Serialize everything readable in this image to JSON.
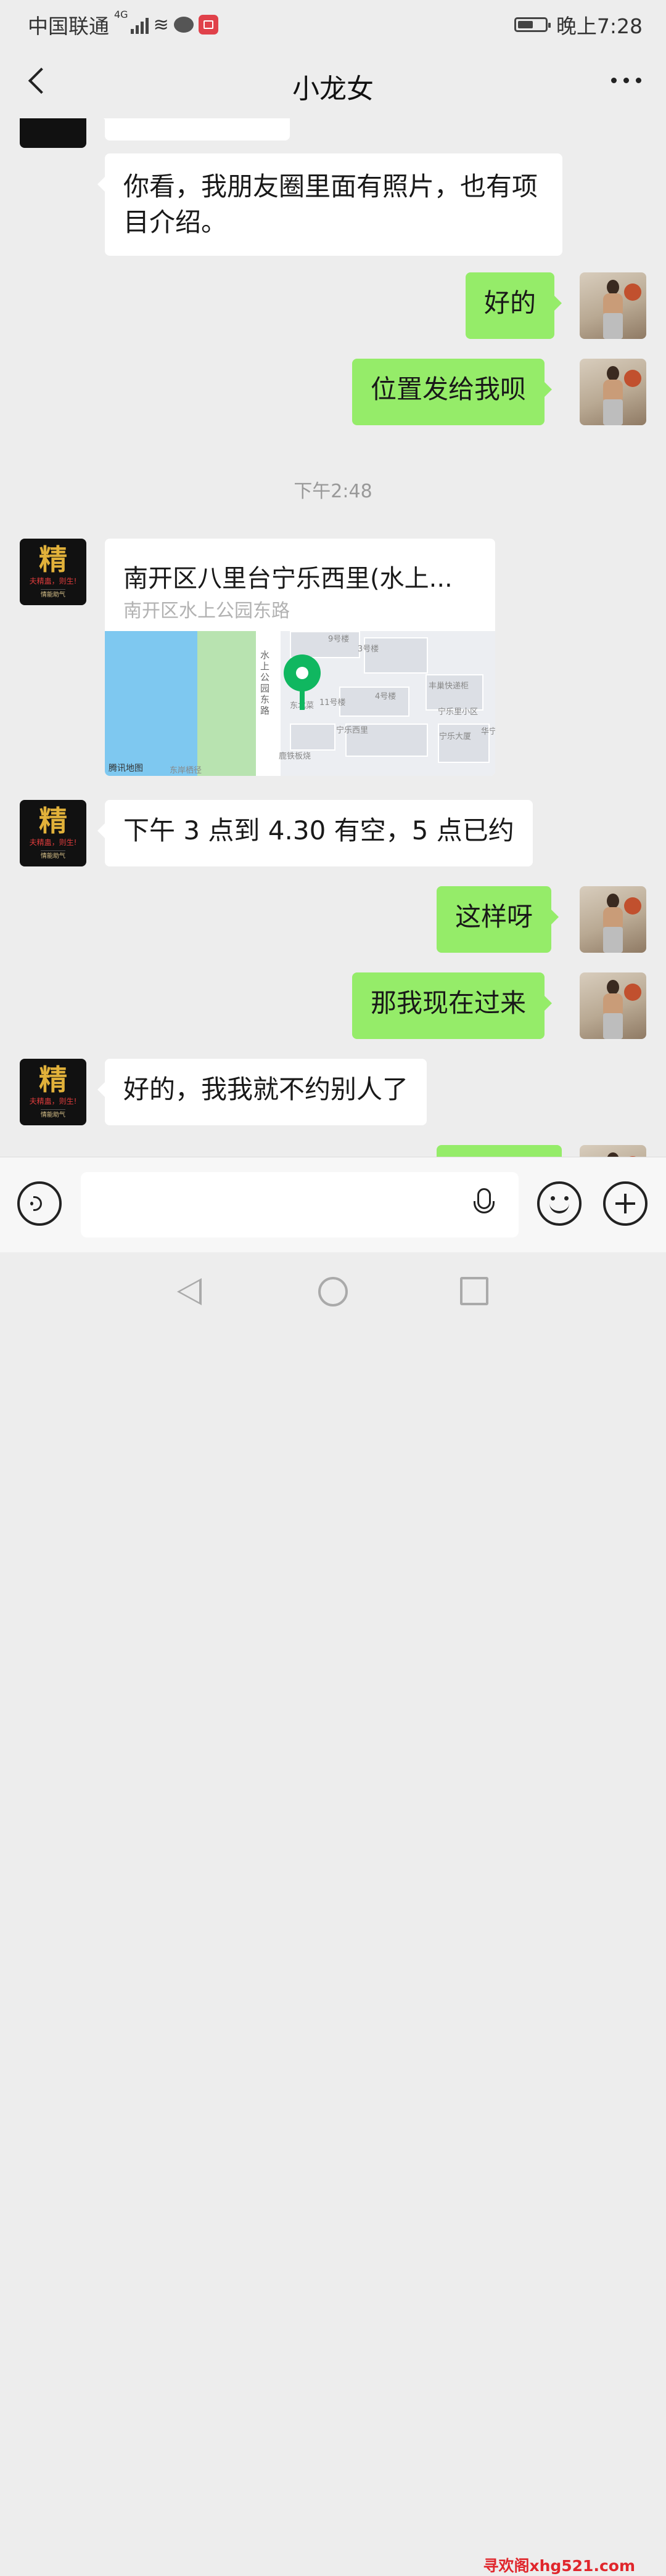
{
  "status_bar": {
    "carrier": "中国联通",
    "network": "4G",
    "time": "晚上7:28"
  },
  "nav": {
    "title": "小龙女"
  },
  "messages": {
    "m0": "你看，我朋友圈里面有照片，也有项目介绍。",
    "m1": "好的",
    "m2": "位置发给我呗",
    "timestamp": "下午2:48",
    "location": {
      "name": "南开区八里台宁乐西里(水上...",
      "address": "南开区水上公园东路",
      "map_labels": {
        "road": "水上公园东路",
        "brand": "腾讯地图",
        "poi1": "丰巢快递柜",
        "poi2": "宁乐里小区",
        "poi3": "宁乐大厦",
        "poi4": "宁乐西里",
        "poi5": "东岸栖径",
        "poi6": "鹿铁板烧",
        "poi7": "华宁",
        "bld1": "9号楼",
        "bld2": "3号楼",
        "bld3": "4号楼",
        "bld4": "11号楼",
        "bld5": "东北菜"
      }
    },
    "m3": "下午 3 点到 4.30 有空，5 点已约",
    "m4": "这样呀",
    "m5": "那我现在过来",
    "m6": "好的，我我就不约别人了"
  },
  "avatar_contact": {
    "char": "精",
    "sub": "夫精蛊，则生!",
    "sub2": "情能助气"
  },
  "input": {
    "value": "",
    "placeholder": ""
  },
  "watermark": "寻欢阁xhg521.com"
}
